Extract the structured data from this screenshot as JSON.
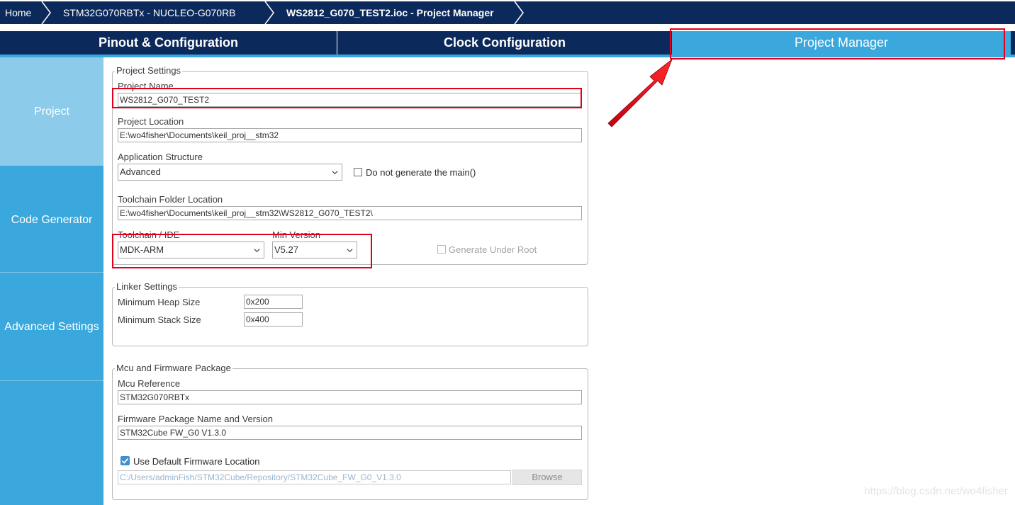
{
  "breadcrumb": {
    "home": "Home",
    "board": "STM32G070RBTx  -  NUCLEO-G070RB",
    "current": "WS2812_G070_TEST2.ioc - Project Manager"
  },
  "tabs": [
    {
      "label": "Pinout & Configuration",
      "active": false
    },
    {
      "label": "Clock Configuration",
      "active": false
    },
    {
      "label": "Project Manager",
      "active": true
    }
  ],
  "sidebar": {
    "items": [
      {
        "label": "Project",
        "active": true
      },
      {
        "label": "Code Generator",
        "active": false
      },
      {
        "label": "Advanced Settings",
        "active": false
      }
    ]
  },
  "project_settings": {
    "title": "Project Settings",
    "project_name_label": "Project Name",
    "project_name_value": "WS2812_G070_TEST2",
    "project_location_label": "Project Location",
    "project_location_value": "E:\\wo4fisher\\Documents\\keil_proj__stm32",
    "app_structure_label": "Application Structure",
    "app_structure_value": "Advanced",
    "no_main_label": "Do not generate the main()",
    "no_main_checked": false,
    "toolchain_folder_label": "Toolchain Folder Location",
    "toolchain_folder_value": "E:\\wo4fisher\\Documents\\keil_proj__stm32\\WS2812_G070_TEST2\\",
    "toolchain_label": "Toolchain / IDE",
    "toolchain_value": "MDK-ARM",
    "min_version_label": "Min Version",
    "min_version_value": "V5.27",
    "generate_under_root_label": "Generate Under Root",
    "generate_under_root_checked": false
  },
  "linker_settings": {
    "title": "Linker Settings",
    "heap_label": "Minimum Heap Size",
    "heap_value": "0x200",
    "stack_label": "Minimum Stack Size",
    "stack_value": "0x400"
  },
  "mcu_firmware": {
    "title": "Mcu and Firmware Package",
    "mcu_ref_label": "Mcu Reference",
    "mcu_ref_value": "STM32G070RBTx",
    "fw_label": "Firmware Package Name and Version",
    "fw_value": "STM32Cube FW_G0 V1.3.0",
    "use_default_label": "Use Default Firmware Location",
    "use_default_checked": true,
    "fw_path_value": "C:/Users/adminFish/STM32Cube/Repository/STM32Cube_FW_G0_V1.3.0",
    "browse_label": "Browse"
  },
  "watermark": "https://blog.csdn.net/wo4fisher",
  "colors": {
    "nav_dark": "#0b2a5b",
    "accent": "#3aa8dc",
    "sidebar_active": "#8ccbea",
    "annotation_red": "#e2001a",
    "checkbox_blue": "#3f8fd2"
  }
}
